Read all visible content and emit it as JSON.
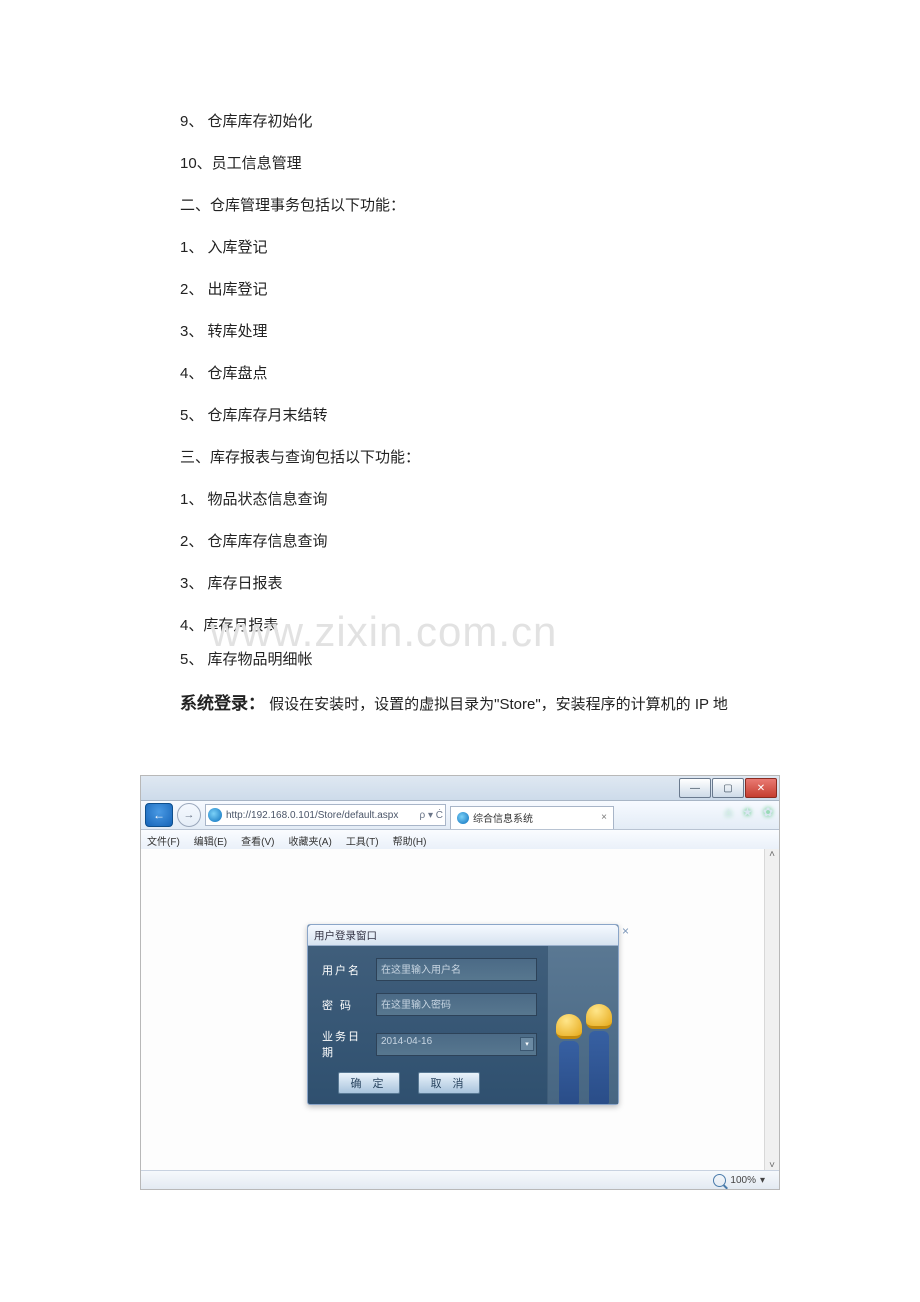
{
  "doc_lines": [
    "9、 仓库库存初始化",
    "10、员工信息管理",
    "二、仓库管理事务包括以下功能：",
    "1、 入库登记",
    "2、 出库登记",
    "3、 转库处理",
    "4、 仓库盘点",
    "5、 仓库库存月末结转",
    "三、库存报表与查询包括以下功能：",
    "1、 物品状态信息查询",
    "2、 仓库库存信息查询",
    "3、 库存日报表",
    "4、库存月报表",
    "5、 库存物品明细帐"
  ],
  "login_heading": {
    "bold": "系统登录：",
    "rest": "假设在安装时，设置的虚拟目录为\"Store\"，安装程序的计算机的 IP 地"
  },
  "watermark": "www.zixin.com.cn",
  "browser": {
    "url": "http://192.168.0.101/Store/default.aspx",
    "search_hint": "ρ ▾ Ċ",
    "tab_label": "综合信息系统",
    "menus": [
      "文件(F)",
      "编辑(E)",
      "查看(V)",
      "收藏夹(A)",
      "工具(T)",
      "帮助(H)"
    ],
    "right_icons": [
      "⌂",
      "★",
      "✿"
    ],
    "zoom": "100%"
  },
  "dialog": {
    "title": "用户登录窗口",
    "close": "×",
    "username_label": "用户名",
    "username_placeholder": "在这里输入用户名",
    "password_label": "密  码",
    "password_placeholder": "在这里输入密码",
    "date_label": "业务日期",
    "date_value": "2014-04-16",
    "ok": "确 定",
    "cancel": "取 消"
  }
}
